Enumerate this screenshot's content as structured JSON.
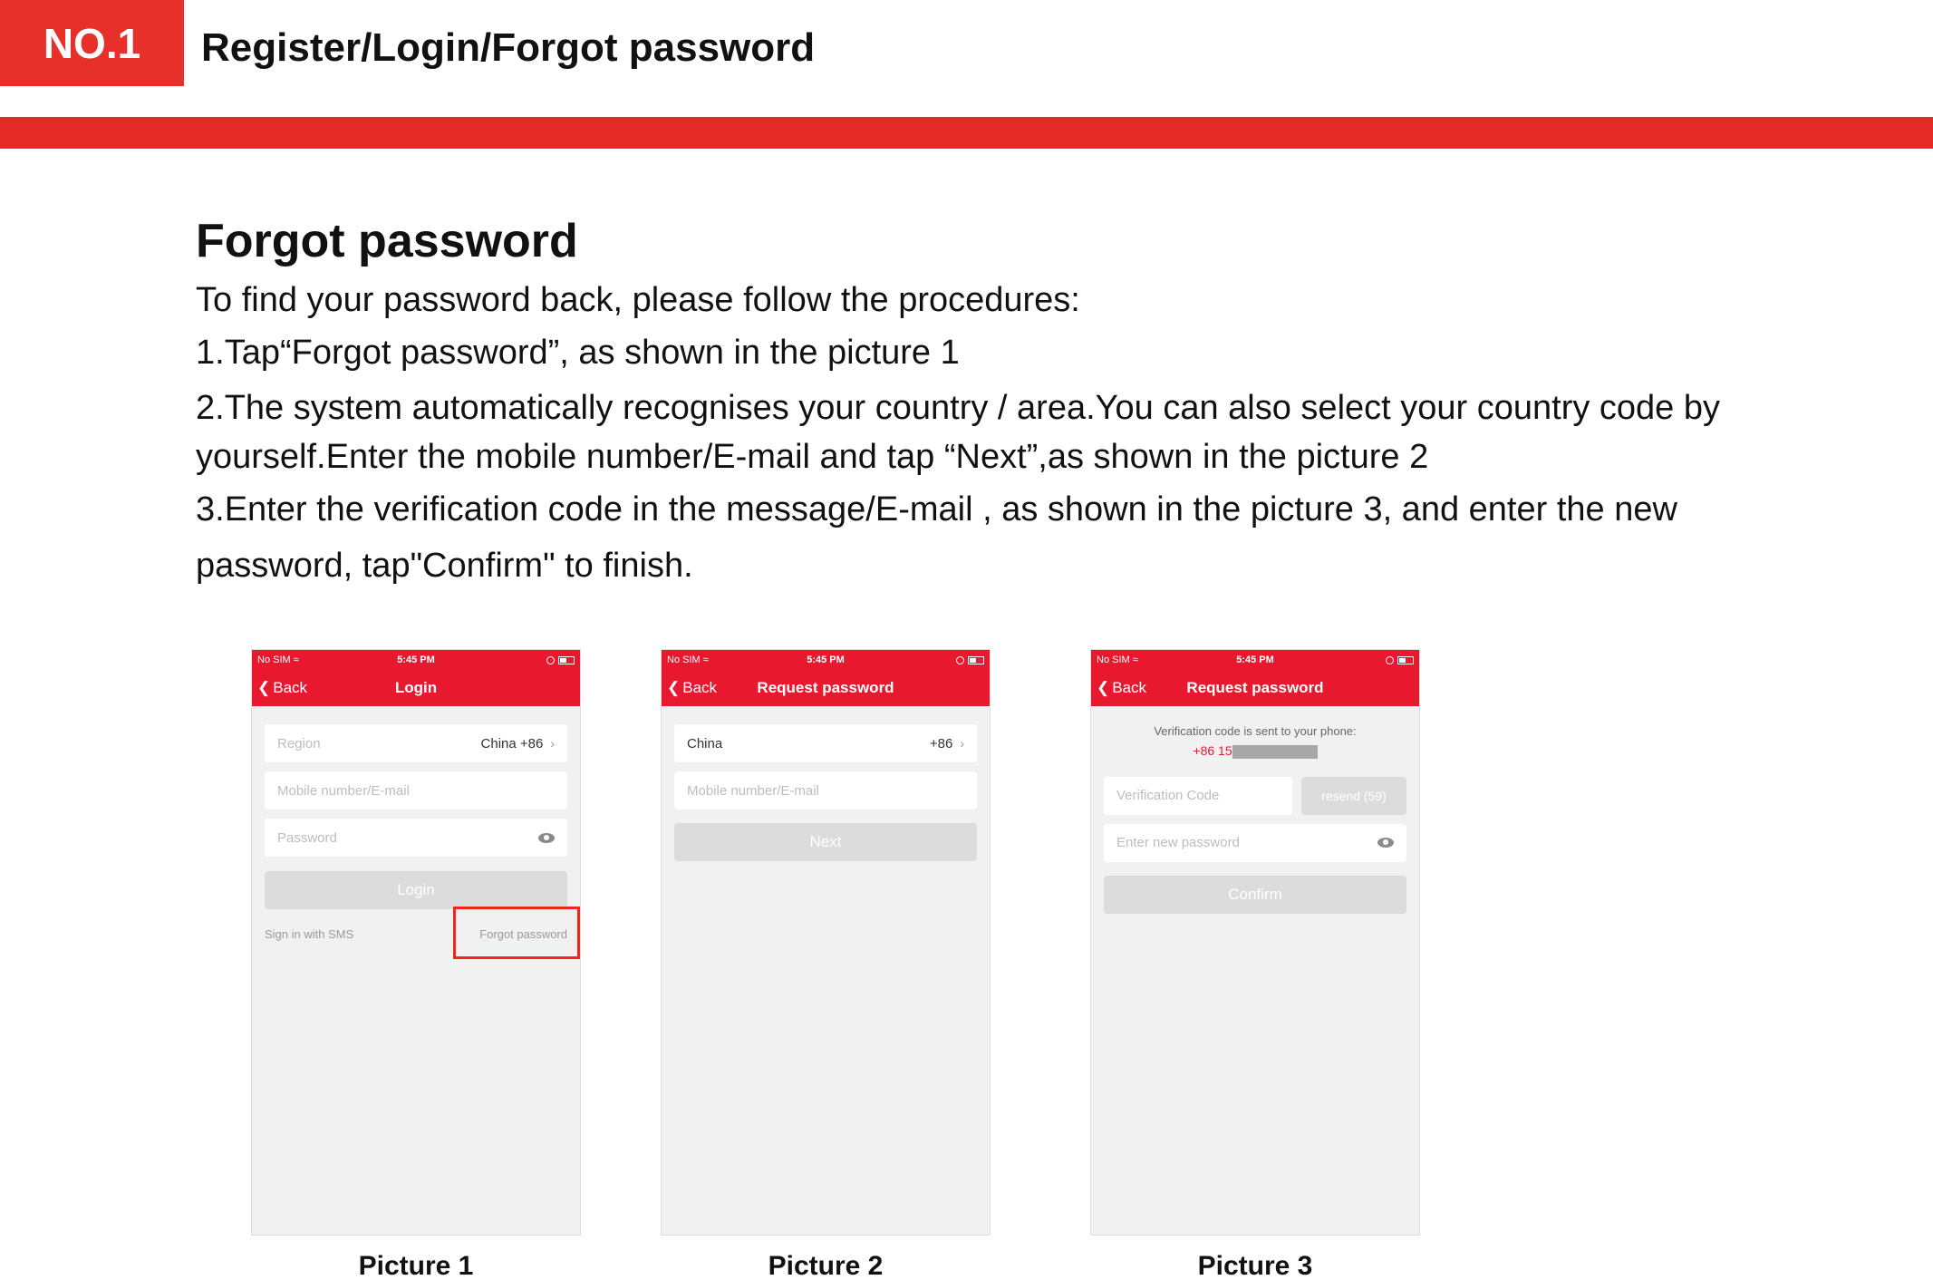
{
  "header": {
    "badge": "NO.1",
    "title": "Register/Login/Forgot password",
    "accent_color": "#e52b26"
  },
  "section": {
    "title": "Forgot password",
    "intro": "To find your password back, please follow the procedures:",
    "steps": [
      "1.Tap“Forgot password”,  as shown in the picture 1",
      "2.The system automatically recognises your country / area.You can also select your country code by",
      "yourself.Enter the mobile number/E-mail and tap “Next”,as shown in the picture 2",
      "3.Enter the verification code in the message/E-mail , as shown in the picture 3,  and enter the new",
      "password,  tap\"Confirm\" to finish."
    ]
  },
  "status_bar": {
    "carrier": "No SIM",
    "time": "5:45 PM",
    "wifi_icon": "wifi-icon",
    "battery_icon": "battery-icon"
  },
  "phones": [
    {
      "caption": "Picture 1",
      "back": "Back",
      "title": "Login",
      "region_label": "Region",
      "region_value": "China +86",
      "mobile_placeholder": "Mobile number/E-mail",
      "password_placeholder": "Password",
      "login_button": "Login",
      "sms_link": "Sign in with SMS",
      "forgot_link": "Forgot password"
    },
    {
      "caption": "Picture 2",
      "back": "Back",
      "title": "Request password",
      "country": "China",
      "country_code": "+86",
      "mobile_placeholder": "Mobile number/E-mail",
      "next_button": "Next"
    },
    {
      "caption": "Picture 3",
      "back": "Back",
      "title": "Request password",
      "message": "Verification code is sent to your phone:",
      "phone_prefix": "+86 15",
      "code_placeholder": "Verification Code",
      "resend_button": "resend (59)",
      "new_password_placeholder": "Enter new password",
      "confirm_button": "Confirm"
    }
  ]
}
